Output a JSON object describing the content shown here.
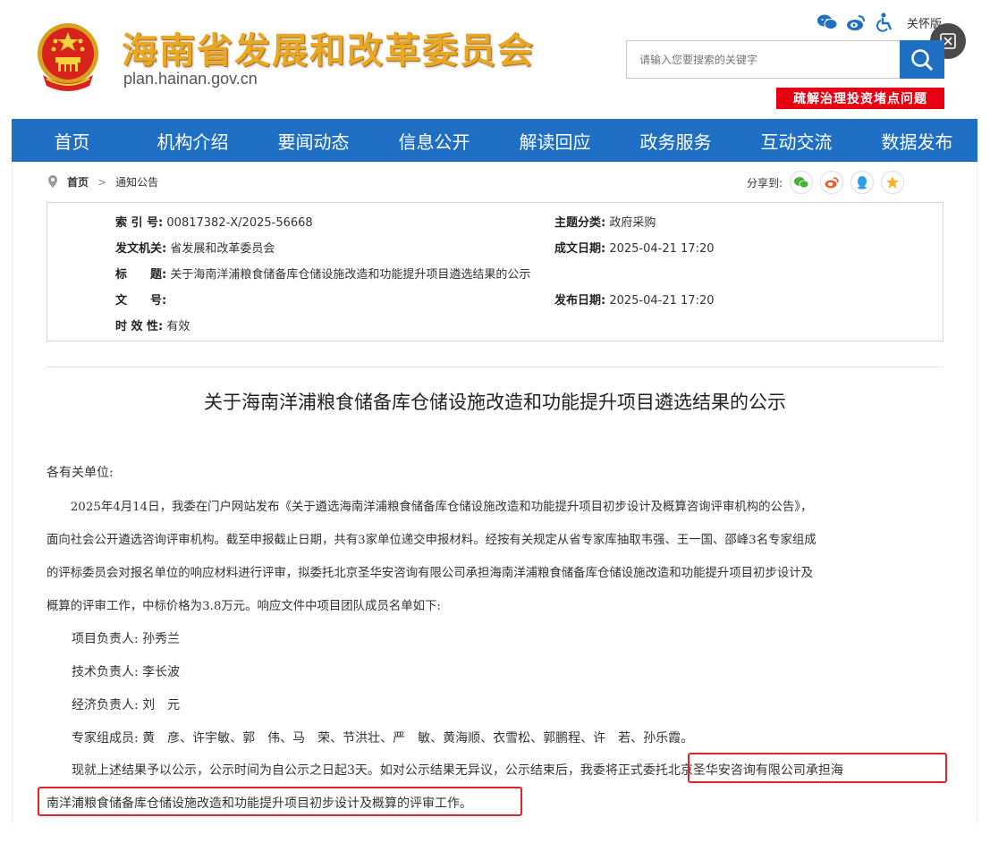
{
  "header": {
    "site_title": "海南省发展和改革委员会",
    "site_url": "plan.hainan.gov.cn",
    "care_mode": "关怀版",
    "search_placeholder": "请输入您要搜索的关键字",
    "red_tag": "疏解治理投资堵点问题"
  },
  "nav": {
    "items": [
      "首页",
      "机构介绍",
      "要闻动态",
      "信息公开",
      "解读回应",
      "政务服务",
      "互动交流",
      "数据发布"
    ]
  },
  "breadcrumb": {
    "home": "首页",
    "separator": ">",
    "current": "通知公告",
    "share_label": "分享到:"
  },
  "info": {
    "index_label": "索 引 号:",
    "index_value": "00817382-X/2025-56668",
    "topic_label": "主题分类:",
    "topic_value": "政府采购",
    "issuer_label": "发文机关:",
    "issuer_value": "省发展和改革委员会",
    "created_label": "成文日期:",
    "created_value": "2025-04-21 17:20",
    "title_label": "标　　题:",
    "title_value": "关于海南洋浦粮食储备库仓储设施改造和功能提升项目遴选结果的公示",
    "docno_label": "文　　号:",
    "docno_value": "",
    "published_label": "发布日期:",
    "published_value": "2025-04-21 17:20",
    "validity_label": "时 效 性:",
    "validity_value": "有效"
  },
  "article": {
    "title": "关于海南洋浦粮食储备库仓储设施改造和功能提升项目遴选结果的公示",
    "greeting": "各有关单位:",
    "p1_lines": [
      "　　2025年4月14日，我委在门户网站发布《关于遴选海南洋浦粮食储备库仓储设施改造和功能提升项目初步设计及概算咨询评审机构的公告》，",
      "面向社会公开遴选咨询评审机构。截至申报截止日期，共有3家单位递交申报材料。经按有关规定从省专家库抽取韦强、王一国、邵峰3名专家组成",
      "的评标委员会对报名单位的响应材料进行评审，拟委托北京圣华安咨询有限公司承担海南洋浦粮食储备库仓储设施改造和功能提升项目初步设计及",
      "概算的评审工作，中标价格为3.8万元。响应文件中项目团队成员名单如下:"
    ],
    "project_lead": "　　项目负责人: 孙秀兰",
    "tech_lead": "　　技术负责人: 李长波",
    "econ_lead": "　　经济负责人: 刘　元",
    "experts": "　　专家组成员: 黄　彦、许宇敏、郭　伟、马　荣、节洪壮、严　敏、黄海顺、衣雪松、郭鹏程、许　若、孙乐霞。",
    "final_line1_a": "　　现就上述结果予以公示，公示时间为自公示之日起3天。如对公示结果无异议，公示结束后，我委将",
    "final_line1_b": "正式委托北京圣华安咨询有限公司承担海",
    "final_line2": "南洋浦粮食储备库仓储设施改造和功能提升项目初步设计及概算的评审工作。"
  },
  "colors": {
    "brand_blue": "#1f6fc5",
    "title_gold": "#e8a825",
    "alert_red": "#e60012",
    "highlight_red": "#e3232a"
  }
}
